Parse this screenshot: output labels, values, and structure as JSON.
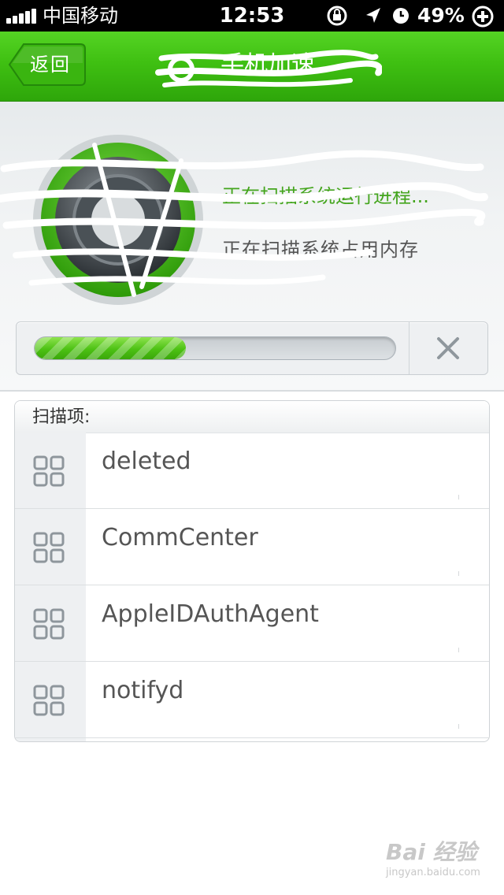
{
  "status_bar": {
    "carrier": "中国移动",
    "time": "12:53",
    "battery": "49%"
  },
  "nav": {
    "back_label": "返回",
    "title": "手机加速"
  },
  "scan": {
    "status_line": "正在扫描系统运行进程...",
    "sub_line": "正在扫描系统占用内存",
    "progress": 0.42,
    "list_header": "扫描项:",
    "items": [
      {
        "name": "deleted"
      },
      {
        "name": "CommCenter"
      },
      {
        "name": "AppleIDAuthAgent"
      },
      {
        "name": "notifyd"
      }
    ]
  },
  "watermark": {
    "brand": "Bai 经验",
    "url": "jingyan.baidu.com"
  },
  "colors": {
    "nav_green": "#3fc012",
    "progress_green": "#4cc113",
    "status_green": "#44a51d"
  },
  "icons": {
    "back": "chevron-left-icon",
    "cancel": "close-icon",
    "row": "grid-icon"
  }
}
